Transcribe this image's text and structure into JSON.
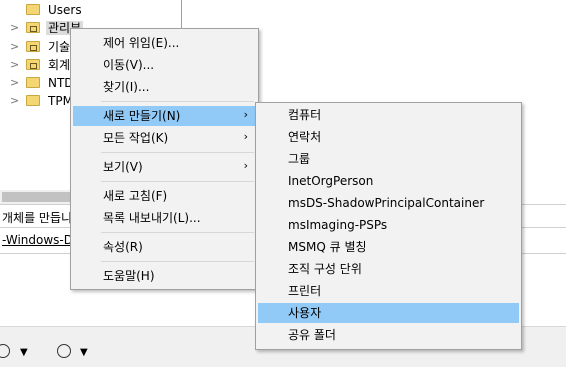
{
  "tree": {
    "items": [
      {
        "label": "Users",
        "chevron": "",
        "ou": false
      },
      {
        "label": "관리부",
        "chevron": ">",
        "ou": true
      },
      {
        "label": "기술",
        "chevron": ">",
        "ou": true
      },
      {
        "label": "회계",
        "chevron": ">",
        "ou": true
      },
      {
        "label": "NTD",
        "chevron": ">",
        "ou": false
      },
      {
        "label": "TPM",
        "chevron": ">",
        "ou": false
      }
    ]
  },
  "description": {
    "line1": "개체를 만듭니",
    "line2": "-Windows-Dis"
  },
  "context_menu": {
    "items": [
      {
        "label": "제어 위임(E)...",
        "submenu": false
      },
      {
        "label": "이동(V)...",
        "submenu": false
      },
      {
        "label": "찾기(I)...",
        "submenu": false
      },
      {
        "label": "새로 만들기(N)",
        "submenu": true,
        "highlighted": true
      },
      {
        "label": "모든 작업(K)",
        "submenu": true
      },
      {
        "label": "보기(V)",
        "submenu": true
      },
      {
        "label": "새로 고침(F)",
        "submenu": false
      },
      {
        "label": "목록 내보내기(L)...",
        "submenu": false
      },
      {
        "label": "속성(R)",
        "submenu": false
      },
      {
        "label": "도움말(H)",
        "submenu": false
      }
    ],
    "submenu_glyph": "›"
  },
  "new_submenu": {
    "items": [
      {
        "label": "컴퓨터"
      },
      {
        "label": "연락처"
      },
      {
        "label": "그룹"
      },
      {
        "label": "InetOrgPerson"
      },
      {
        "label": "msDS-ShadowPrincipalContainer"
      },
      {
        "label": "msImaging-PSPs"
      },
      {
        "label": "MSMQ 큐 별칭"
      },
      {
        "label": "조직 구성 단위"
      },
      {
        "label": "프린터"
      },
      {
        "label": "사용자",
        "highlighted": true
      },
      {
        "label": "공유 폴더"
      }
    ]
  },
  "toolbar": {
    "icons": [
      "view-list-icon",
      "save-icon"
    ],
    "dropdown_glyph": "▼"
  },
  "colors": {
    "highlight": "#91c9f7",
    "menu_bg": "#f2f2f2",
    "folder": "#f4d673"
  }
}
